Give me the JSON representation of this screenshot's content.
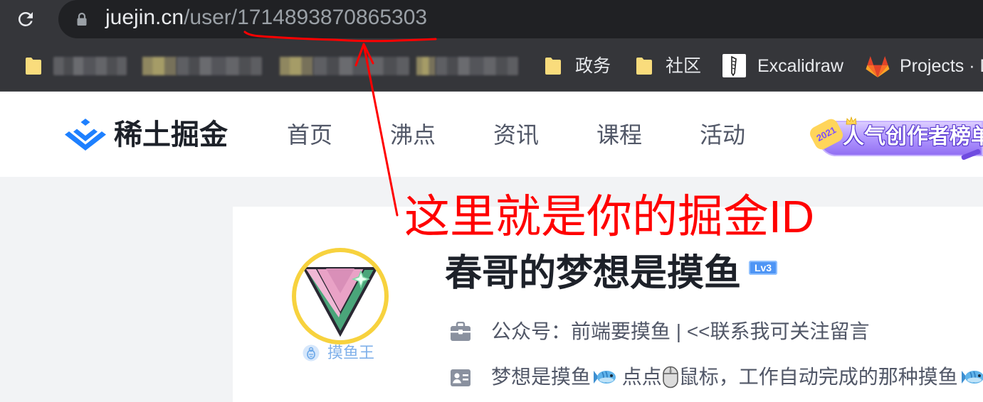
{
  "browser": {
    "reload_icon": "reload-icon",
    "url": {
      "lock_icon": "lock-icon",
      "host": "juejin.cn",
      "path": "/user/1714893870865303"
    },
    "bookmarks": [
      {
        "icon": "folder-icon",
        "blurred": true
      },
      {
        "icon": "folder-icon",
        "blurred": true
      },
      {
        "icon": "folder-icon",
        "blurred": true
      },
      {
        "icon": "folder-icon",
        "blurred": true
      },
      {
        "icon": "folder-icon",
        "label": "政务"
      },
      {
        "icon": "folder-icon",
        "label": "社区"
      },
      {
        "icon": "excalidraw-icon",
        "label": "Excalidraw"
      },
      {
        "icon": "gitlab-icon",
        "label": "Projects · D"
      }
    ]
  },
  "site_header": {
    "logo_icon": "juejin-logo-icon",
    "logo_text": "稀土掘金",
    "nav": [
      "首页",
      "沸点",
      "资讯",
      "课程",
      "活动"
    ],
    "banner": {
      "year": "2021",
      "title": "人气创作者榜单"
    }
  },
  "profile": {
    "avatar_badge": {
      "icon": "fish-king-badge-icon",
      "label": "摸鱼王"
    },
    "name": "春哥的梦想是摸鱼",
    "level": "Lv3",
    "position": {
      "icon": "briefcase-icon",
      "text": "公众号：前端要摸鱼 | <<联系我可关注留言"
    },
    "intro": {
      "icon": "id-card-icon",
      "segments": [
        "梦想是摸鱼",
        " 点点",
        "鼠标，工作自动完成的那种摸鱼"
      ],
      "emoji": [
        "fish-emoji",
        "computer-mouse-emoji",
        "fish-emoji"
      ]
    }
  },
  "annotation": {
    "text": "这里就是你的掘金ID"
  },
  "colors": {
    "chrome_toolbar": "#35363a",
    "omnibox": "#202124",
    "folder": "#f9dc7c",
    "brand_blue": "#1e80ff",
    "nav_text": "#515767",
    "page_bg": "#f2f3f5",
    "avatar_ring": "#f7d23e",
    "level_badge": "#4e95f5",
    "annotation_red": "#ff0000"
  }
}
